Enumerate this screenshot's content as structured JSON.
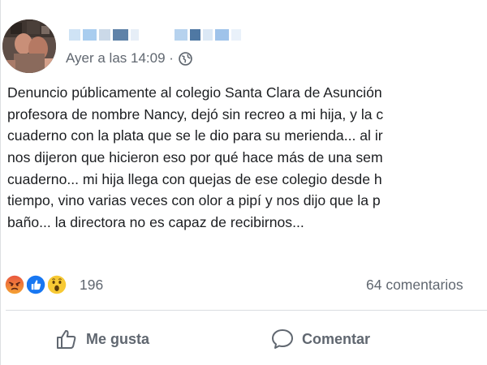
{
  "post": {
    "author": {
      "name_obscured": true
    },
    "timestamp": "Ayer a las 14:09 ·",
    "audience_icon": "globe-icon",
    "body_lines": [
      "Denuncio públicamente al colegio Santa Clara de Asunción",
      "profesora de nombre Nancy, dejó sin recreo a mi hija, y la c",
      "cuaderno con la plata que se le dio para su merienda... al ir",
      "nos dijeron que hicieron eso por qué hace más de una sem",
      "cuaderno... mi hija llega con quejas de ese colegio desde h",
      "tiempo, vino varias veces con olor a pipí y nos dijo que la p",
      "baño... la directora no es capaz de recibirnos..."
    ],
    "reactions": {
      "icons": [
        "angry-reaction-icon",
        "like-reaction-icon",
        "wow-reaction-icon"
      ],
      "count": "196"
    },
    "comments": {
      "count_label": "64 comentarios"
    },
    "actions": {
      "like_label": "Me gusta",
      "comment_label": "Comentar"
    },
    "colors": {
      "text": "#1c1e21",
      "secondary": "#606770",
      "divider": "#dadde1",
      "like_blue": "#1877f2",
      "angry": "#e9573f",
      "wow_yellow": "#f7c934"
    }
  }
}
